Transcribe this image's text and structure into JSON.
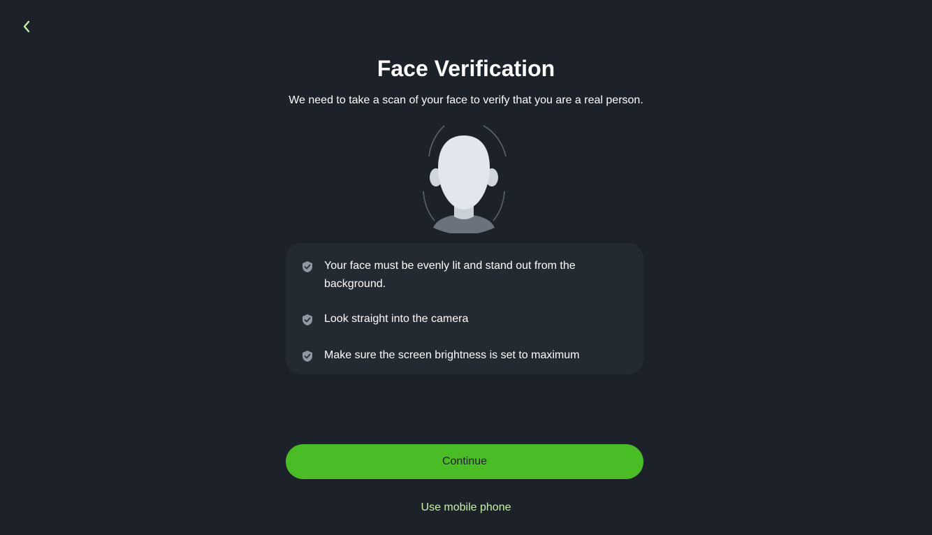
{
  "header": {
    "back_icon": "chevron-left-icon"
  },
  "main": {
    "title": "Face Verification",
    "subtitle": "We need to take a scan of your face to verify that you are a real person.",
    "illustration_icon": "face-scan-icon",
    "tips": [
      {
        "icon": "shield-check-icon",
        "text": "Your face must be evenly lit and stand out from the background."
      },
      {
        "icon": "shield-check-icon",
        "text": "Look straight into the camera"
      },
      {
        "icon": "shield-check-icon",
        "text": "Make sure the screen brightness is set to maximum"
      }
    ],
    "continue_label": "Continue",
    "mobile_link_label": "Use mobile phone"
  },
  "colors": {
    "background": "#1d222a",
    "card": "#242a32",
    "accent": "#4abd26",
    "link": "#c6f2a6",
    "back_icon": "#c6f2a6"
  }
}
